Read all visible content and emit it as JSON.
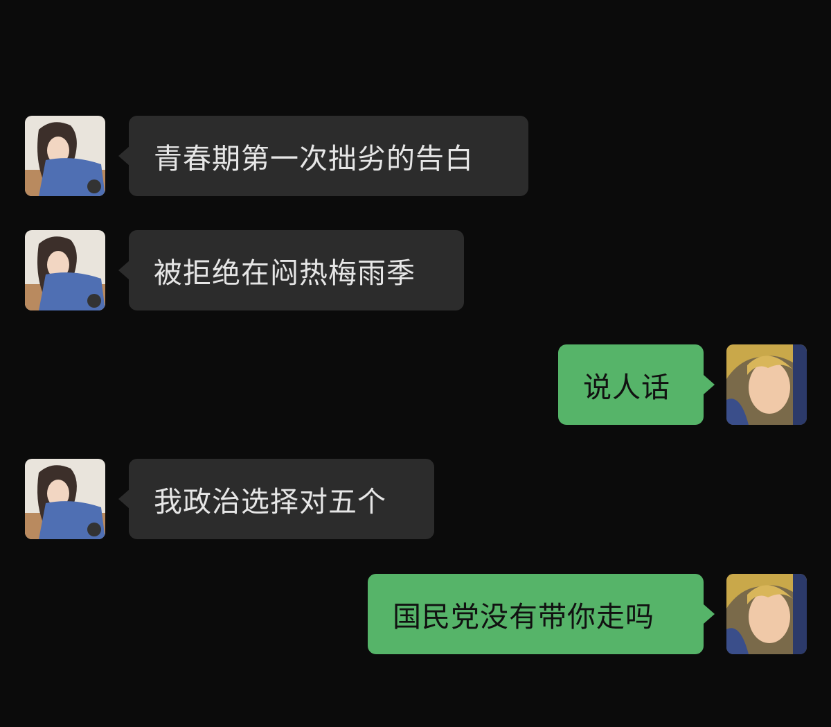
{
  "conversation": {
    "messages": [
      {
        "sender": "other",
        "text": "青春期第一次拙劣的告白",
        "avatar": "anime-girl-avatar"
      },
      {
        "sender": "other",
        "text": "被拒绝在闷热梅雨季",
        "avatar": "anime-girl-avatar"
      },
      {
        "sender": "self",
        "text": "说人话",
        "avatar": "anime-boy-avatar"
      },
      {
        "sender": "other",
        "text": "我政治选择对五个",
        "avatar": "anime-girl-avatar"
      },
      {
        "sender": "self",
        "text": "国民党没有带你走吗",
        "avatar": "anime-boy-avatar"
      }
    ]
  },
  "colors": {
    "background": "#0b0b0b",
    "incoming_bubble": "#2c2c2c",
    "outgoing_bubble": "#56b469"
  }
}
